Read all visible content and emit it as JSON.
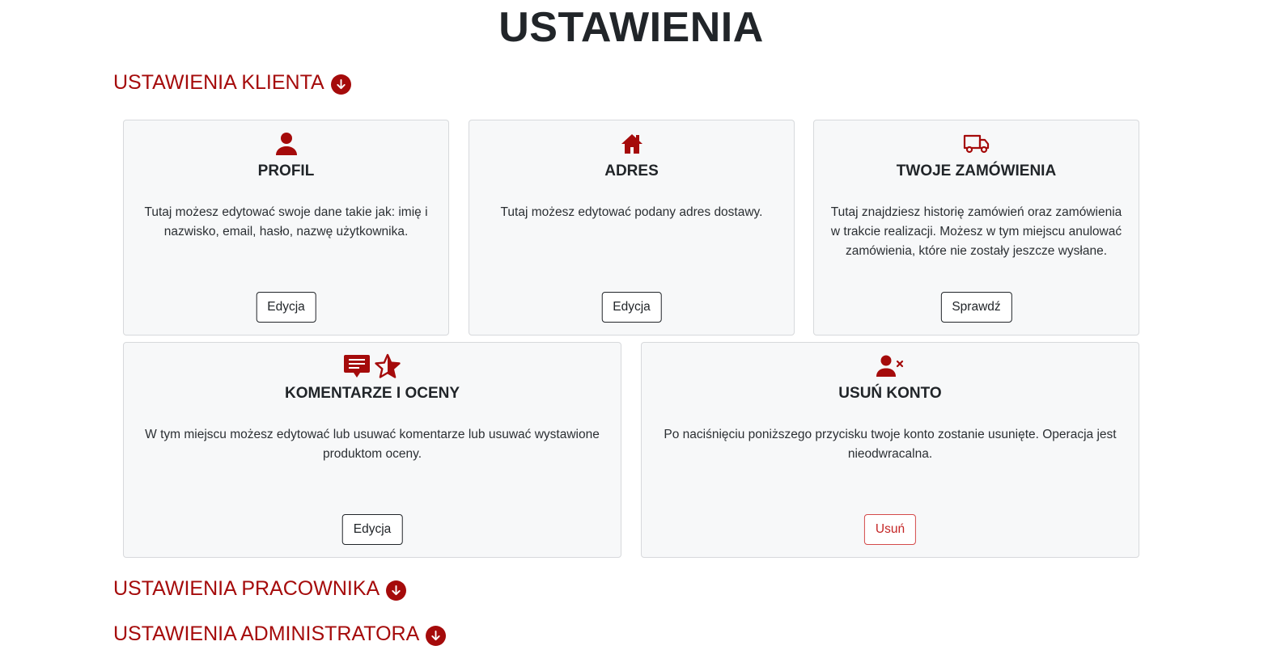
{
  "page": {
    "title": "USTAWIENIA"
  },
  "sections": {
    "client": "USTAWIENIA KLIENTA",
    "employee": "USTAWIENIA PRACOWNIKA",
    "admin": "USTAWIENIA ADMINISTRATORA"
  },
  "cards": {
    "profile": {
      "icon": "user-icon",
      "title": "PROFIL",
      "text": "Tutaj możesz edytować swoje dane takie jak: imię i nazwisko, email, hasło, nazwę użytkownika.",
      "button": "Edycja"
    },
    "address": {
      "icon": "house-icon",
      "title": "ADRES",
      "text": "Tutaj możesz edytować podany adres dostawy.",
      "button": "Edycja"
    },
    "orders": {
      "icon": "truck-icon",
      "title": "TWOJE ZAMÓWIENIA",
      "text": "Tutaj znajdziesz historię zamówień oraz zamówienia w trakcie realizacji. Możesz w tym miejscu anulować zamówienia, które nie zostały jeszcze wysłane.",
      "button": "Sprawdź"
    },
    "reviews": {
      "icons": [
        "comment-icon",
        "star-icon"
      ],
      "title": "KOMENTARZE I OCENY",
      "text": "W tym miejscu możesz edytować lub usuwać komentarze lub usuwać wystawione produktom oceny.",
      "button": "Edycja"
    },
    "delete_account": {
      "icon": "user-remove-icon",
      "title": "USUŃ KONTO",
      "text": "Po naciśnięciu poniższego przycisku twoje konto zostanie usunięte. Operacja jest nieodwracalna.",
      "button": "Usuń"
    }
  },
  "colors": {
    "accent": "#a50b0b",
    "card_bg": "#f7f8f9",
    "danger": "#d44a4a"
  }
}
